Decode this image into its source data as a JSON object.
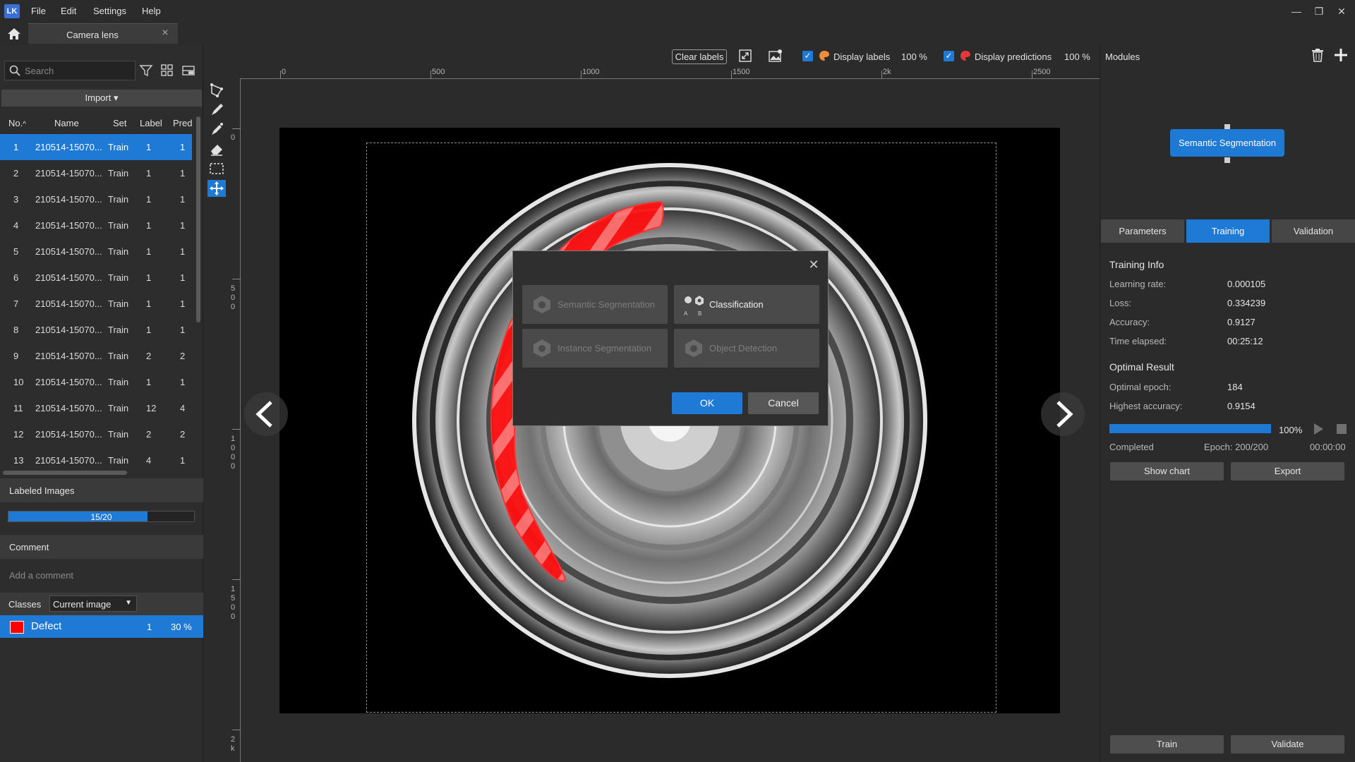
{
  "app": {
    "logo_text": "LK",
    "menu": [
      "File",
      "Edit",
      "Settings",
      "Help"
    ],
    "window_controls": {
      "minimize": "—",
      "restore": "❐",
      "close": "✕"
    }
  },
  "tab": {
    "label": "Camera lens"
  },
  "left": {
    "search_placeholder": "Search",
    "import_label": "Import ▾",
    "columns": [
      "No.",
      "Name",
      "Set",
      "Label",
      "Pred"
    ],
    "sort_indicator": "^",
    "rows": [
      {
        "no": "1",
        "name": "210514-15070...",
        "set": "Train",
        "label": "1",
        "pred": "1"
      },
      {
        "no": "2",
        "name": "210514-15070...",
        "set": "Train",
        "label": "1",
        "pred": "1"
      },
      {
        "no": "3",
        "name": "210514-15070...",
        "set": "Train",
        "label": "1",
        "pred": "1"
      },
      {
        "no": "4",
        "name": "210514-15070...",
        "set": "Train",
        "label": "1",
        "pred": "1"
      },
      {
        "no": "5",
        "name": "210514-15070...",
        "set": "Train",
        "label": "1",
        "pred": "1"
      },
      {
        "no": "6",
        "name": "210514-15070...",
        "set": "Train",
        "label": "1",
        "pred": "1"
      },
      {
        "no": "7",
        "name": "210514-15070...",
        "set": "Train",
        "label": "1",
        "pred": "1"
      },
      {
        "no": "8",
        "name": "210514-15070...",
        "set": "Train",
        "label": "1",
        "pred": "1"
      },
      {
        "no": "9",
        "name": "210514-15070...",
        "set": "Train",
        "label": "2",
        "pred": "2"
      },
      {
        "no": "10",
        "name": "210514-15070...",
        "set": "Train",
        "label": "1",
        "pred": "1"
      },
      {
        "no": "11",
        "name": "210514-15070...",
        "set": "Train",
        "label": "12",
        "pred": "4"
      },
      {
        "no": "12",
        "name": "210514-15070...",
        "set": "Train",
        "label": "2",
        "pred": "2"
      },
      {
        "no": "13",
        "name": "210514-15070...",
        "set": "Train",
        "label": "4",
        "pred": "1"
      }
    ],
    "selected_row": 1,
    "labeled_images": {
      "title": "Labeled Images",
      "text": "15/20",
      "fraction": 0.75
    },
    "comment": {
      "title": "Comment",
      "placeholder": "Add a comment"
    },
    "classes": {
      "title": "Classes",
      "scope": "Current image",
      "items": [
        {
          "name": "Defect",
          "count": "1",
          "percent": "30 %",
          "color": "#ff0000"
        }
      ]
    }
  },
  "toolbar": {
    "clear_labels": "Clear labels",
    "display_labels": {
      "checked": true,
      "label": "Display labels",
      "opacity": "100 %"
    },
    "display_predictions": {
      "checked": true,
      "label": "Display predictions",
      "opacity": "100 %"
    }
  },
  "ruler": {
    "h_labels": [
      "0",
      "500",
      "1000",
      "1500",
      "2k",
      "2500"
    ],
    "v_labels": [
      "0",
      "500",
      "1000",
      "1500",
      "2k"
    ]
  },
  "dialog": {
    "options": [
      {
        "label": "Semantic Segmentation",
        "enabled": false
      },
      {
        "label": "Classification",
        "enabled": true,
        "sub_a": "A",
        "sub_b": "B"
      },
      {
        "label": "Instance Segmentation",
        "enabled": false
      },
      {
        "label": "Object Detection",
        "enabled": false
      }
    ],
    "ok": "OK",
    "cancel": "Cancel"
  },
  "right": {
    "modules_title": "Modules",
    "module_node": "Semantic Segmentation",
    "tabs": [
      "Parameters",
      "Training",
      "Validation"
    ],
    "active_tab": "Training",
    "training_info": {
      "title": "Training Info",
      "items": [
        {
          "key": "Learning rate:",
          "value": "0.000105"
        },
        {
          "key": "Loss:",
          "value": "0.334239"
        },
        {
          "key": "Accuracy:",
          "value": "0.9127"
        },
        {
          "key": "Time elapsed:",
          "value": "00:25:12"
        }
      ]
    },
    "optimal_result": {
      "title": "Optimal Result",
      "items": [
        {
          "key": "Optimal epoch:",
          "value": "184"
        },
        {
          "key": "Highest accuracy:",
          "value": "0.9154"
        }
      ]
    },
    "progress": {
      "percent": "100%",
      "fraction": 1.0,
      "status": "Completed",
      "epoch": "Epoch: 200/200",
      "remaining": "00:00:00"
    },
    "buttons": {
      "show_chart": "Show chart",
      "export": "Export",
      "train": "Train",
      "validate": "Validate"
    }
  },
  "colors": {
    "accent": "#1f7ad6",
    "defect": "#ff0000",
    "panel": "#2b2b2b"
  }
}
